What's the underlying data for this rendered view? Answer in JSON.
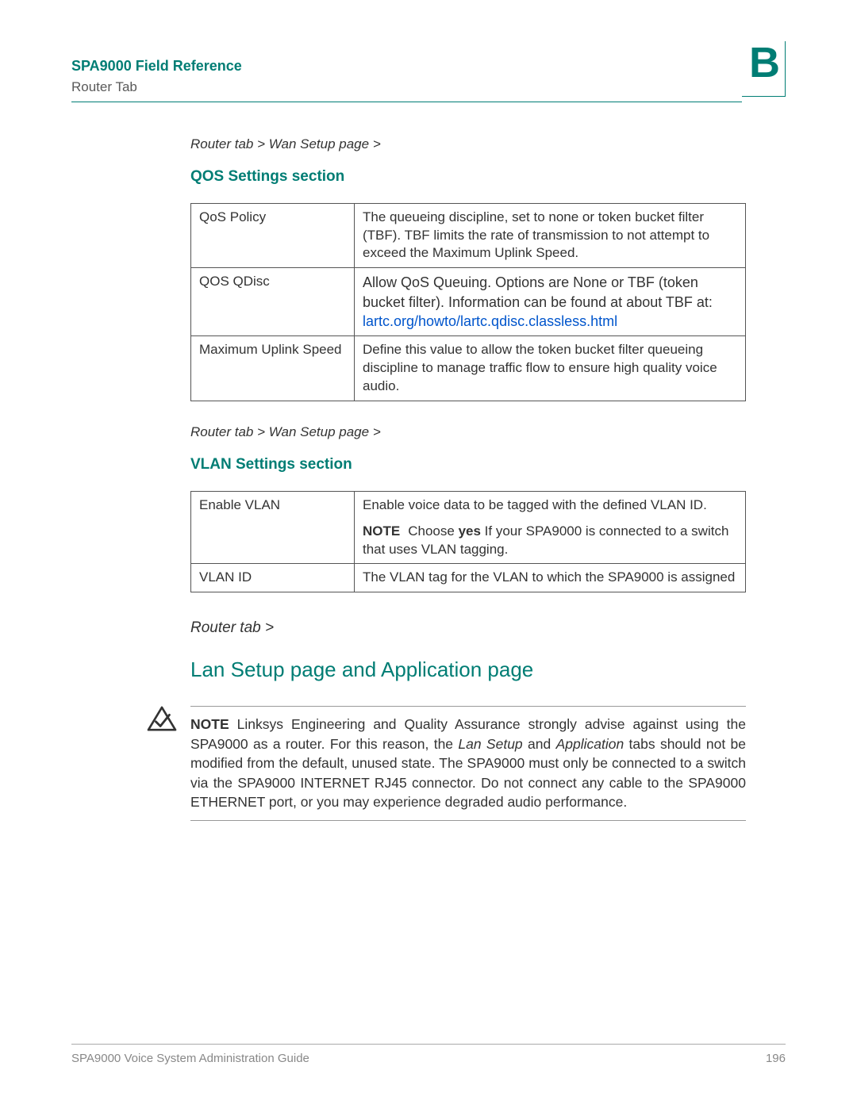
{
  "header": {
    "doc_title": "SPA9000 Field Reference",
    "tab_title": "Router Tab",
    "appendix_letter": "B"
  },
  "qos": {
    "breadcrumb": "Router tab > Wan Setup page >",
    "heading": "QOS Settings section",
    "rows": [
      {
        "field": "QoS Policy",
        "desc": "The queueing discipline, set to none or token bucket filter (TBF). TBF limits the rate of transmission to not attempt to exceed the Maximum Uplink Speed."
      },
      {
        "field": "QOS QDisc",
        "desc_pre": "Allow QoS Queuing. Options are None or TBF (token bucket filter). Information can be found at about TBF at: ",
        "link": "lartc.org/howto/lartc.qdisc.classless.html"
      },
      {
        "field": "Maximum Uplink Speed",
        "desc": "Define this value to allow the token bucket filter queueing discipline to manage traffic flow to ensure high quality voice audio."
      }
    ]
  },
  "vlan": {
    "breadcrumb": "Router tab > Wan Setup page >",
    "heading": "VLAN Settings section",
    "rows": [
      {
        "field": "Enable VLAN",
        "desc": "Enable voice data to be tagged with the defined VLAN ID.",
        "note_label": "NOTE",
        "note_pre": "Choose ",
        "note_bold": "yes",
        "note_post": " If your SPA9000 is connected to a switch that uses VLAN tagging."
      },
      {
        "field": "VLAN ID",
        "desc": "The VLAN tag for the VLAN to which the SPA9000 is assigned"
      }
    ]
  },
  "lan": {
    "breadcrumb": "Router tab >",
    "heading": "Lan Setup page and Application page",
    "note_label": "NOTE",
    "note_p1": "Linksys Engineering and Quality Assurance strongly advise against using the SPA9000 as a router. For this reason, the ",
    "note_i1": "Lan Setup",
    "note_mid1": " and ",
    "note_i2": "Application",
    "note_p2": " tabs should not be modified from the default, unused state. The SPA9000 must only be connected to a switch via the SPA9000 INTERNET RJ45 connector. Do not connect any cable to the SPA9000 ETHERNET port, or you may experience degraded audio performance."
  },
  "footer": {
    "guide": "SPA9000 Voice System Administration Guide",
    "page": "196"
  }
}
